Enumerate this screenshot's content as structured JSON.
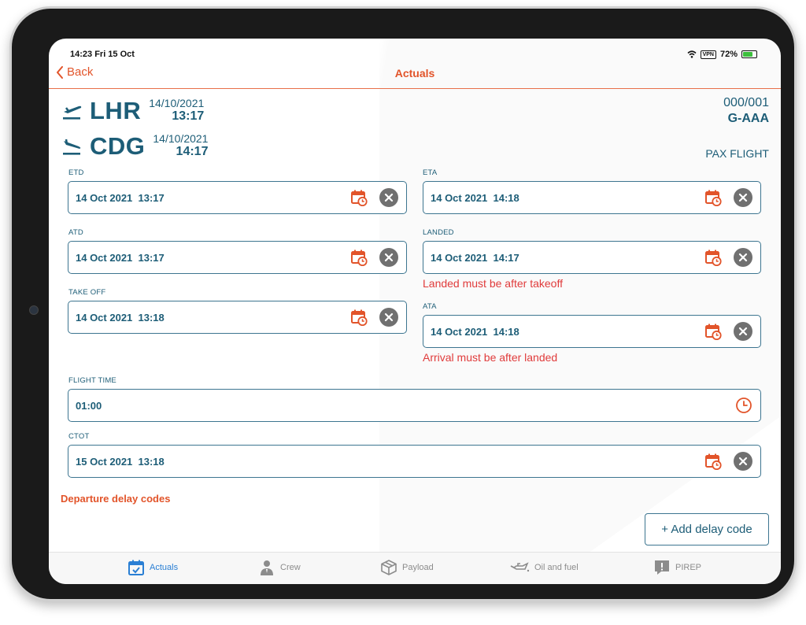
{
  "status_bar": {
    "time": "14:23  Fri 15 Oct",
    "vpn": "VPN",
    "battery": "72%"
  },
  "nav": {
    "back_label": "Back",
    "title": "Actuals"
  },
  "flight": {
    "departure": {
      "code": "LHR",
      "date": "14/10/2021",
      "time": "13:17"
    },
    "arrival": {
      "code": "CDG",
      "date": "14/10/2021",
      "time": "14:17"
    },
    "number": "000/001",
    "registration": "G-AAA",
    "type": "PAX FLIGHT"
  },
  "fields": {
    "etd": {
      "label": "ETD",
      "value": "14 Oct 2021  13:17"
    },
    "eta": {
      "label": "ETA",
      "value": "14 Oct 2021  14:18"
    },
    "atd": {
      "label": "ATD",
      "value": "14 Oct 2021  13:17"
    },
    "landed": {
      "label": "LANDED",
      "value": "14 Oct 2021  14:17",
      "error": "Landed must be after takeoff"
    },
    "take_off": {
      "label": "TAKE OFF",
      "value": "14 Oct 2021  13:18"
    },
    "ata": {
      "label": "ATA",
      "value": "14 Oct 2021  14:18",
      "error": "Arrival must be after landed"
    },
    "flight_time": {
      "label": "FLIGHT TIME",
      "value": "01:00"
    },
    "ctot": {
      "label": "CTOT",
      "value": "15 Oct 2021  13:18"
    }
  },
  "delay": {
    "section_title": "Departure delay codes",
    "add_button": "+ Add delay code"
  },
  "tabs": [
    {
      "label": "Actuals",
      "icon": "calendar-check-icon",
      "active": true
    },
    {
      "label": "Crew",
      "icon": "crew-icon",
      "active": false
    },
    {
      "label": "Payload",
      "icon": "box-icon",
      "active": false
    },
    {
      "label": "Oil and fuel",
      "icon": "oil-can-icon",
      "active": false
    },
    {
      "label": "PIREP",
      "icon": "report-icon",
      "active": false
    }
  ],
  "colors": {
    "accent": "#e2542a",
    "primary": "#1d5d77",
    "error": "#e03b3b",
    "tab_active": "#2a7fd4"
  }
}
